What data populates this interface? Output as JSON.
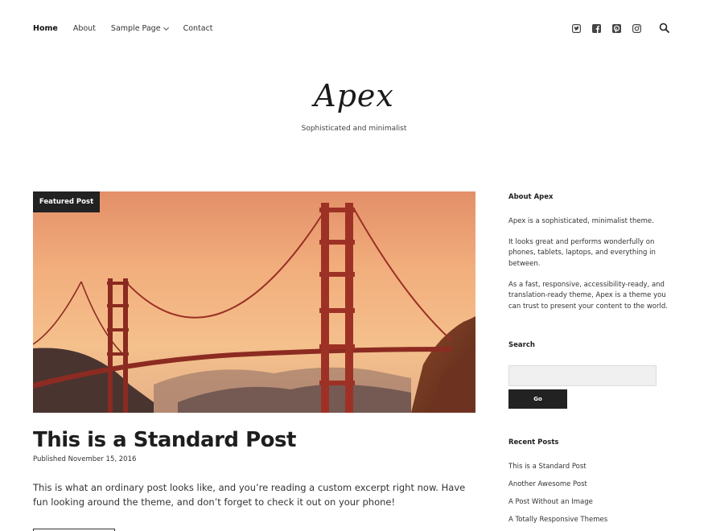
{
  "nav": {
    "items": [
      {
        "label": "Home",
        "active": true
      },
      {
        "label": "About",
        "active": false
      },
      {
        "label": "Sample Page",
        "active": false,
        "has_dropdown": true
      },
      {
        "label": "Contact",
        "active": false
      }
    ]
  },
  "social": [
    "twitter-icon",
    "facebook-icon",
    "pinterest-icon",
    "instagram-icon"
  ],
  "header": {
    "site_title": "Apex",
    "tagline": "Sophisticated and minimalist"
  },
  "post": {
    "featured_label": "Featured Post",
    "title": "This is a Standard Post",
    "meta": "Published November 15, 2016",
    "excerpt": "This is what an ordinary post looks like, and you’re reading a custom excerpt right now. Have fun looking around the theme, and don’t forget to check it out on your phone!"
  },
  "sidebar": {
    "about_title": "About Apex",
    "about_p1": "Apex is a sophisticated, minimalist theme.",
    "about_p2": "It looks great and performs wonderfully on phones, tablets, laptops, and everything in between.",
    "about_p3": "As a fast, responsive, accessibility-ready, and translation-ready theme, Apex is a theme you can trust to present your content to the world.",
    "search_title": "Search",
    "search_button": "Go",
    "recent_title": "Recent Posts",
    "recent_posts": [
      "This is a Standard Post",
      "Another Awesome Post",
      "A Post Without an Image",
      "A Totally Responsive Themes"
    ]
  },
  "colors": {
    "dark": "#222222",
    "sky_top": "#e8a070",
    "bridge": "#a8322a"
  }
}
